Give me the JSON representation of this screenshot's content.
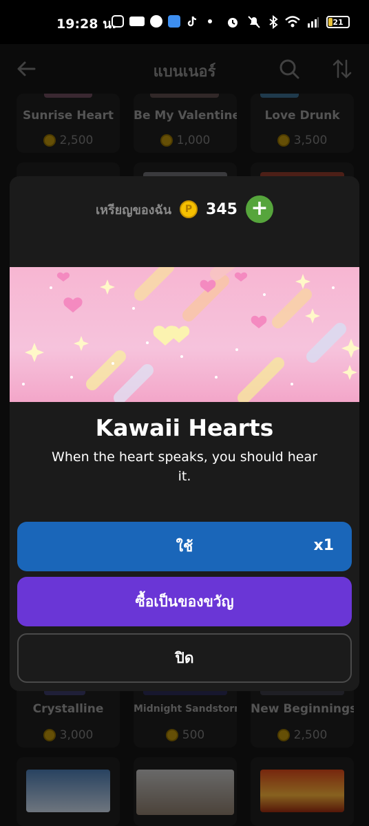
{
  "status_bar": {
    "time": "19:28 น.",
    "battery": "21"
  },
  "header": {
    "title": "แบนเนอร์"
  },
  "grid": {
    "row1": [
      {
        "name": "Sunrise Heart",
        "price": "2,500"
      },
      {
        "name": "Be My Valentine",
        "price": "1,000"
      },
      {
        "name": "Love Drunk",
        "price": "3,500"
      }
    ],
    "row3": [
      {
        "name": "Crystalline",
        "price": "3,000"
      },
      {
        "name": "Midnight Sandstorm",
        "price": "500"
      },
      {
        "name": "New Beginnings",
        "price": "2,500"
      }
    ]
  },
  "modal": {
    "wallet_label": "เหรียญของฉัน",
    "coin_symbol": "P",
    "wallet_amount": "345",
    "add_symbol": "+",
    "title": "Kawaii Hearts",
    "description": "When the heart speaks, you should hear it.",
    "use_label": "ใช้",
    "use_quantity": "x1",
    "gift_label": "ซื้อเป็นของขวัญ",
    "close_label": "ปิด"
  },
  "colors": {
    "use_button": "#1a66b9",
    "gift_button": "#6a36d6",
    "add_button": "#56a53c",
    "coin": "#f6c000"
  }
}
